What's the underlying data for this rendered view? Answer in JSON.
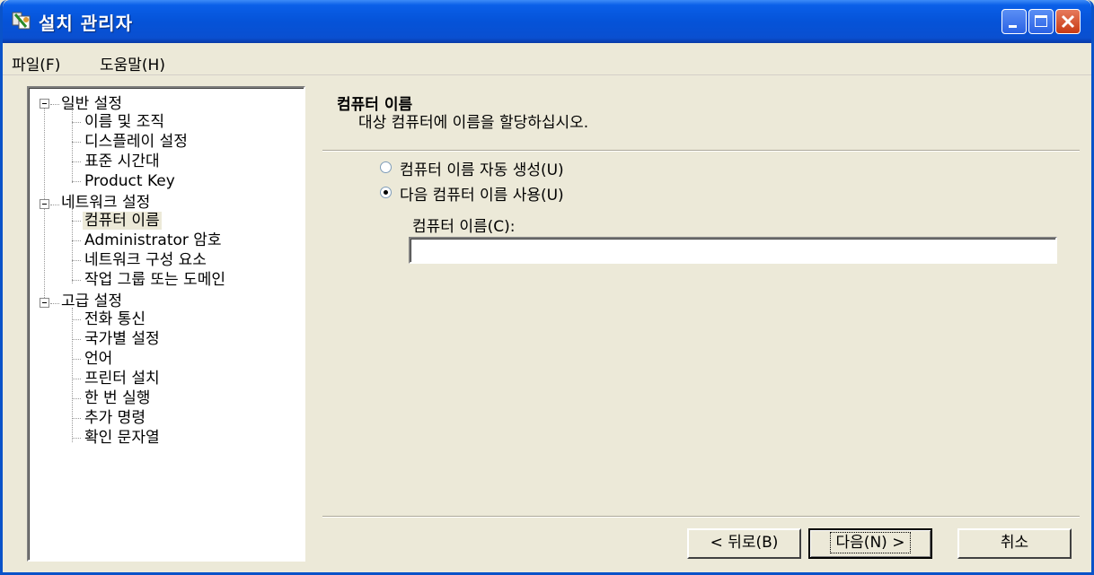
{
  "window": {
    "title": "설치 관리자",
    "title_bar_color": "#0553d8",
    "controls": [
      "minimize-icon",
      "maximize-icon",
      "close-icon"
    ]
  },
  "menu": {
    "file": "파일(F)",
    "help": "도움말(H)"
  },
  "tree": {
    "groups": [
      {
        "label": "일반 설정",
        "items": [
          "이름 및 조직",
          "디스플레이 설정",
          "표준 시간대",
          "Product Key"
        ]
      },
      {
        "label": "네트워크 설정",
        "items": [
          "컴퓨터 이름",
          "Administrator 암호",
          "네트워크 구성 요소",
          "작업 그룹 또는 도메인"
        ]
      },
      {
        "label": "고급 설정",
        "items": [
          "전화 통신",
          "국가별 설정",
          "언어",
          "프린터 설치",
          "한 번 실행",
          "추가 명령",
          "확인 문자열"
        ]
      }
    ],
    "selected": "컴퓨터 이름"
  },
  "page": {
    "heading": "컴퓨터 이름",
    "subtitle": "대상 컴퓨터에 이름을 할당하십시오.",
    "options": [
      {
        "label": "컴퓨터 이름 자동 생성(U)",
        "checked": false
      },
      {
        "label": "다음 컴퓨터 이름 사용(U)",
        "checked": true
      }
    ],
    "name_field_label": "컴퓨터 이름(C):",
    "name_field_value": ""
  },
  "buttons": {
    "back": "< 뒤로(B)",
    "next": "다음(N) >",
    "cancel": "취소"
  }
}
